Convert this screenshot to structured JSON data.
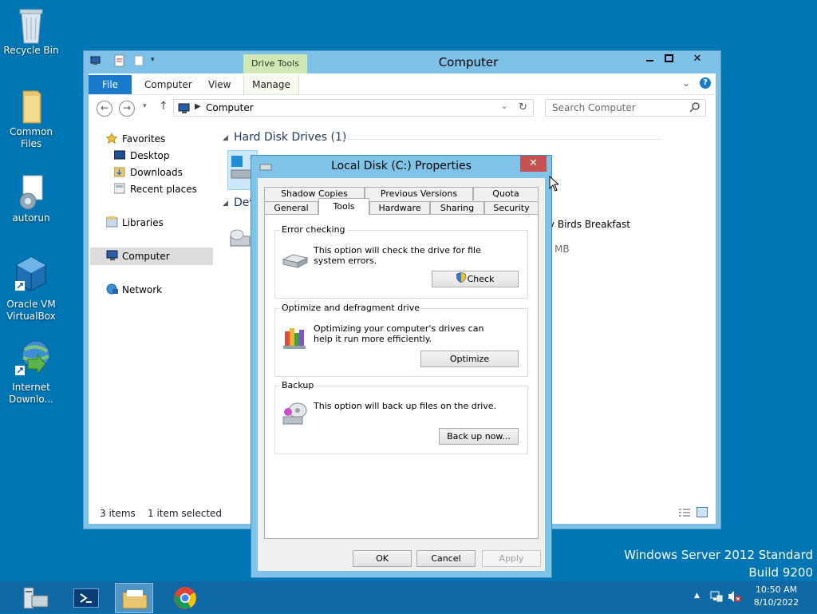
{
  "desktop": {
    "icons": [
      {
        "label": "Recycle Bin",
        "icon": "recycle-bin-icon"
      },
      {
        "label": "Common Files",
        "icon": "folder-icon"
      },
      {
        "label": "autorun",
        "icon": "settings-file-icon"
      },
      {
        "label": "Oracle VM VirtualBox",
        "icon": "virtualbox-icon"
      },
      {
        "label": "Internet Downlo...",
        "icon": "internet-download-manager-icon"
      }
    ],
    "watermark_line1": "Windows Server 2012 Standard",
    "watermark_line2": "Build 9200"
  },
  "explorer": {
    "title": "Computer",
    "context_tab": "Drive Tools",
    "ribbon_tabs": [
      "File",
      "Computer",
      "View",
      "Manage"
    ],
    "address": "Computer",
    "search_placeholder": "Search Computer",
    "nav": {
      "favorites": "Favorites",
      "desktop": "Desktop",
      "downloads": "Downloads",
      "recent": "Recent places",
      "libraries": "Libraries",
      "computer": "Computer",
      "network": "Network"
    },
    "section_hdd": "Hard Disk Drives (1)",
    "section_dev": "Dev",
    "dev_item_name": "ry Birds Breakfast",
    "dev_item_size": "MB",
    "status_items": "3 items",
    "status_selected": "1 item selected"
  },
  "dialog": {
    "title": "Local Disk (C:) Properties",
    "tabs_row1": [
      "Shadow Copies",
      "Previous Versions",
      "Quota"
    ],
    "tabs_row2": [
      "General",
      "Tools",
      "Hardware",
      "Sharing",
      "Security"
    ],
    "active_tab": "Tools",
    "error_checking": {
      "title": "Error checking",
      "text": "This option will check the drive for file system errors.",
      "button": "Check"
    },
    "optimize": {
      "title": "Optimize and defragment drive",
      "text": "Optimizing your computer's drives can help it run more efficiently.",
      "button": "Optimize"
    },
    "backup": {
      "title": "Backup",
      "text": "This option will back up files on the drive.",
      "button": "Back up now..."
    },
    "ok": "OK",
    "cancel": "Cancel",
    "apply": "Apply"
  },
  "taskbar": {
    "time": "10:50 AM",
    "date": "8/10/2022"
  },
  "colors": {
    "desktop": "#0076b5",
    "taskbar": "#0f69a4",
    "window_frame": "#7dc0e8",
    "file_tab": "#1979ca",
    "close_button": "#c75050"
  }
}
